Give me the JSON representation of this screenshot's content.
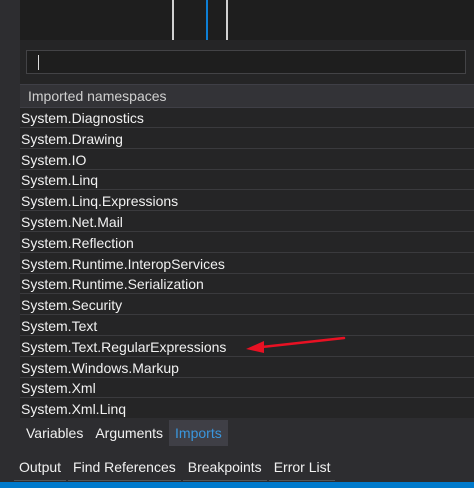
{
  "colors": {
    "accent": "#007acc",
    "active_tab_text": "#3a96dd",
    "annotation_arrow": "#e81123",
    "designer_line_white": "#d0d0d0",
    "designer_line_blue": "#0e7fd6"
  },
  "search": {
    "value": "",
    "placeholder": ""
  },
  "list_header": "Imported namespaces",
  "namespaces": [
    "System.Diagnostics",
    "System.Drawing",
    "System.IO",
    "System.Linq",
    "System.Linq.Expressions",
    "System.Net.Mail",
    "System.Reflection",
    "System.Runtime.InteropServices",
    "System.Runtime.Serialization",
    "System.Security",
    "System.Text",
    "System.Text.RegularExpressions",
    "System.Windows.Markup",
    "System.Xml",
    "System.Xml.Linq"
  ],
  "designer_tabs": [
    {
      "label": "Variables",
      "active": false
    },
    {
      "label": "Arguments",
      "active": false
    },
    {
      "label": "Imports",
      "active": true
    }
  ],
  "tool_windows": [
    {
      "label": "Output"
    },
    {
      "label": "Find References"
    },
    {
      "label": "Breakpoints"
    },
    {
      "label": "Error List"
    }
  ],
  "annotation": {
    "icon": "red-arrow-icon",
    "points_to": "System.Text.RegularExpressions"
  }
}
